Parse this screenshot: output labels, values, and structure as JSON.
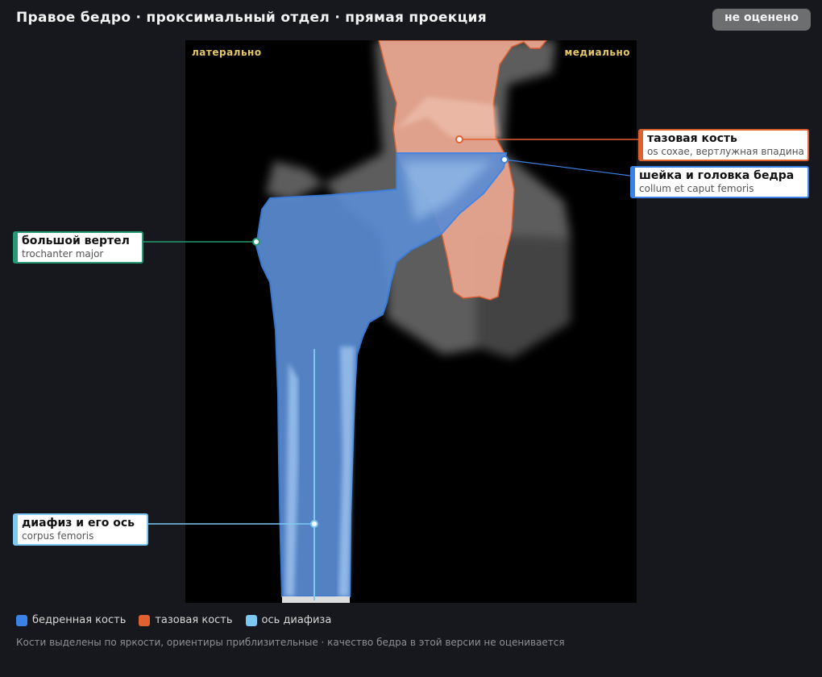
{
  "header": {
    "title": "Правое бедро · проксимальный отдел · прямая проекция",
    "status_badge": "не оценено"
  },
  "image": {
    "orientation_left": "латерально",
    "orientation_right": "медиально"
  },
  "callouts": {
    "pelvis": {
      "title": "тазовая кость",
      "subtitle": "os coxae, вертлужная впадина",
      "color": "#e0602e"
    },
    "neck": {
      "title": "шейка и головка бедра",
      "subtitle": "collum et caput femoris",
      "color": "#3b82e6"
    },
    "trochanter": {
      "title": "большой вертел",
      "subtitle": "trochanter major",
      "color": "#239a72"
    },
    "shaft": {
      "title": "диафиз и его ось",
      "subtitle": "corpus femoris",
      "color": "#7cc8f2"
    }
  },
  "legend": {
    "items": [
      {
        "label": "бедренная кость",
        "color": "#3b82e6"
      },
      {
        "label": "тазовая кость",
        "color": "#e0602e"
      },
      {
        "label": "ось диафиза",
        "color": "#7cc8f2"
      }
    ]
  },
  "footnote": "Кости выделены по яркости, ориентиры приблизительные · качество бедра в этой версии не оценивается"
}
